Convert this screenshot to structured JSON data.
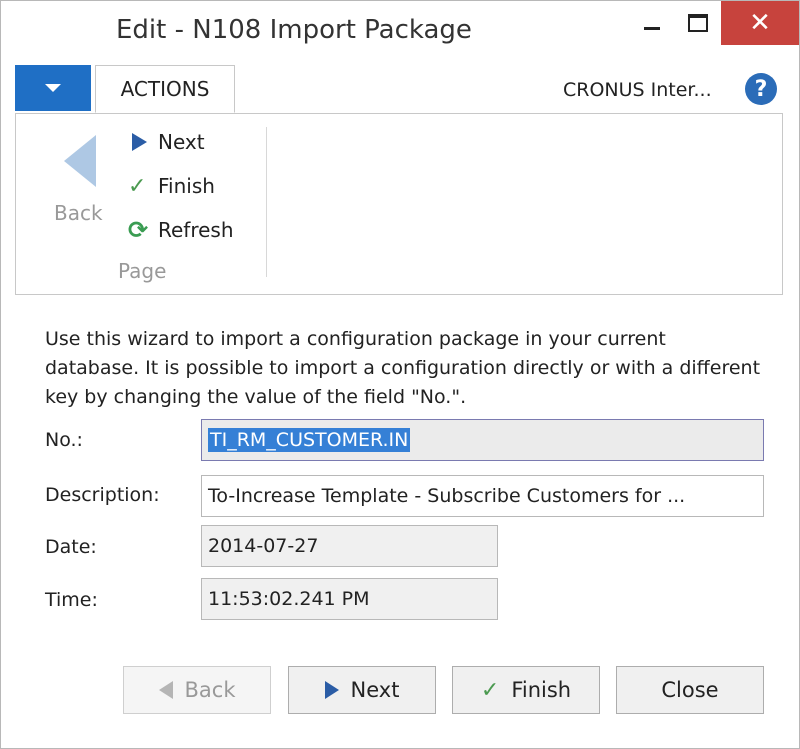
{
  "window": {
    "title": "Edit - N108 Import Package",
    "close_glyph": "✕"
  },
  "ribbon": {
    "tab_actions": "ACTIONS",
    "company": "CRONUS Inter...",
    "help_glyph": "?",
    "back_label": "Back",
    "next_label": "Next",
    "finish_label": "Finish",
    "refresh_label": "Refresh",
    "group_label": "Page"
  },
  "content": {
    "intro": "Use this wizard to import a configuration package in your current database. It is possible to import a configuration directly or with a different key by changing the value of the field \"No.\".",
    "fields": {
      "no_label": "No.:",
      "no_value": "TI_RM_CUSTOMER.IN",
      "description_label": "Description:",
      "description_value": "To-Increase Template - Subscribe Customers for ...",
      "date_label": "Date:",
      "date_value": "2014-07-27",
      "time_label": "Time:",
      "time_value": "11:53:02.241 PM"
    }
  },
  "footer": {
    "back": "Back",
    "next": "Next",
    "finish": "Finish",
    "close": "Close"
  },
  "icons": {
    "check": "✓",
    "refresh": "⟳"
  },
  "colors": {
    "close_button": "#c7433d",
    "menu_button": "#1f6fc5",
    "selection": "#3580d6",
    "next_arrow": "#2b5da6",
    "check": "#4b9a50"
  }
}
